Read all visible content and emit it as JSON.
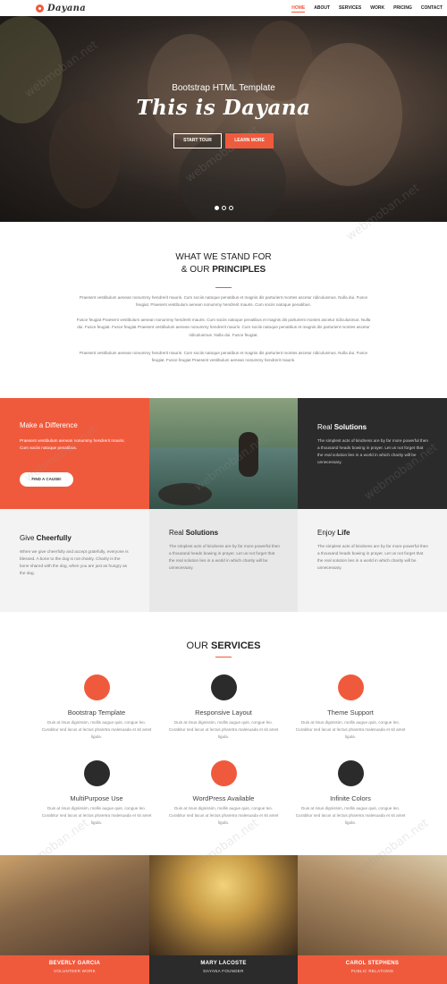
{
  "brand": {
    "name": "Dayana",
    "accent": "#f05a3c",
    "dark": "#2b2b2b"
  },
  "nav": {
    "items": [
      "HOME",
      "ABOUT",
      "SERVICES",
      "WORK",
      "PRICING",
      "CONTACT"
    ],
    "active": "HOME"
  },
  "hero": {
    "subtitle": "Bootstrap HTML Template",
    "title": "This is Dayana",
    "start_button": "START TOUR",
    "learn_button": "LEARN MORE",
    "slides": 3,
    "active_slide": 1
  },
  "principles": {
    "title_line1": "WHAT WE STAND FOR",
    "title_line2_prefix": "& OUR ",
    "title_line2_bold": "PRINCIPLES",
    "paragraphs": [
      "Praesent vestibulum aenean nonummy hendrerit mauris. Cum sociis natoque penatibus et magnis dis parturient montes ascetur ridiculusmus. Nulla dui. Fusce feugiat. Praesent vestibulum aenean nonummy hendrerit mauris. Cum sociis natoque penatibus.",
      "Fusce feugiat Praesent vestibulum aenean nonummy hendrerit mauris. Cum sociis natoque penatibus et magnis dis parturient montes ascetur ridiculusmus. Nulla dui. Fusce feugiat. Fusce feugiat Praesent vestibulum aenean nonummy hendrerit mauris. Cum sociis natoque penatibus et magnis dis parturient montes ascetur ridiculusmus. Nulla dui. Fusce feugiat.",
      "Praesent vestibulum aenean nonummy hendrerit mauris. Cum sociis natoque penatibus et magnis dis parturient montes ascetur ridiculusmus. Nulla dui. Fusce feugiat. Fusce feugiat Praesent vestibulum aenean nonummy hendrerit mauris."
    ]
  },
  "features": {
    "difference": {
      "title": "Make a Difference",
      "text": "Praesent vestibulum aenean nonummy hendrerit mauris. Cum sociis natoque penatibus.",
      "button": "FIND A CAUSE!"
    },
    "solutions_dark": {
      "title_prefix": "Real ",
      "title_bold": "Solutions",
      "text": "The simplest acts of kindness are by far more powerful then a thousand heads bowing in prayer. Let us not forget that the real solution lies in a world in which charity will be unnecessary."
    },
    "give": {
      "title_prefix": "Give ",
      "title_bold": "Cheerfully",
      "text": "When we give cheerfully and accept gratefully, everyone is blessed. A bone to the dog is not charity. Charity is the bone shared with the dog, when you are just as hungry as the dog."
    },
    "solutions": {
      "title_prefix": "Real ",
      "title_bold": "Solutions",
      "text": "The simplest acts of kindness are by far more powerful then a thousand heads bowing in prayer. Let us not forget that the real solution lies in a world in which charity will be unnecessary."
    },
    "enjoy": {
      "title_prefix": "Enjoy ",
      "title_bold": "Life",
      "text": "The simplest acts of kindness are by far more powerful then a thousand heads bowing in prayer. Let us not forget that the real solution lies in a world in which charity will be unnecessary."
    }
  },
  "services": {
    "title_prefix": "OUR ",
    "title_bold": "SERVICES",
    "items": [
      {
        "name": "Bootstrap Template",
        "color": "#f05a3c",
        "desc": "Duis at risus dignissim, mollis augue quis, congue leo. Curabitur sed lacus ut lectus pharetra malesuada et sit amet ligula."
      },
      {
        "name": "Responsive Layout",
        "color": "#2b2b2b",
        "desc": "Duis at risus dignissim, mollis augue quis, congue leo. Curabitur sed lacus ut lectus pharetra malesuada et sit amet ligula."
      },
      {
        "name": "Theme Support",
        "color": "#f05a3c",
        "desc": "Duis at risus dignissim, mollis augue quis, congue leo. Curabitur sed lacus ut lectus pharetra malesuada et sit amet ligula."
      },
      {
        "name": "MultiPurpose Use",
        "color": "#2b2b2b",
        "desc": "Duis at risus dignissim, mollis augue quis, congue leo. Curabitur sed lacus ut lectus pharetra malesuada et sit amet ligula."
      },
      {
        "name": "WordPress Available",
        "color": "#f05a3c",
        "desc": "Duis at risus dignissim, mollis augue quis, congue leo. Curabitur sed lacus ut lectus pharetra malesuada et sit amet ligula."
      },
      {
        "name": "Infinite Colors",
        "color": "#2b2b2b",
        "desc": "Duis at risus dignissim, mollis augue quis, congue leo. Curabitur sed lacus ut lectus pharetra malesuada et sit amet ligula."
      }
    ]
  },
  "team": [
    {
      "name": "BEVERLY GARCIA",
      "role": "VOLUNTEER WORK",
      "color": "#f05a3c"
    },
    {
      "name": "MARY LACOSTE",
      "role": "DAYANA FOUNDER",
      "color": "#2b2b2b"
    },
    {
      "name": "CAROL STEPHENS",
      "role": "PUBLIC RELATIONS",
      "color": "#f05a3c"
    }
  ],
  "watermark": "webmoban.net"
}
